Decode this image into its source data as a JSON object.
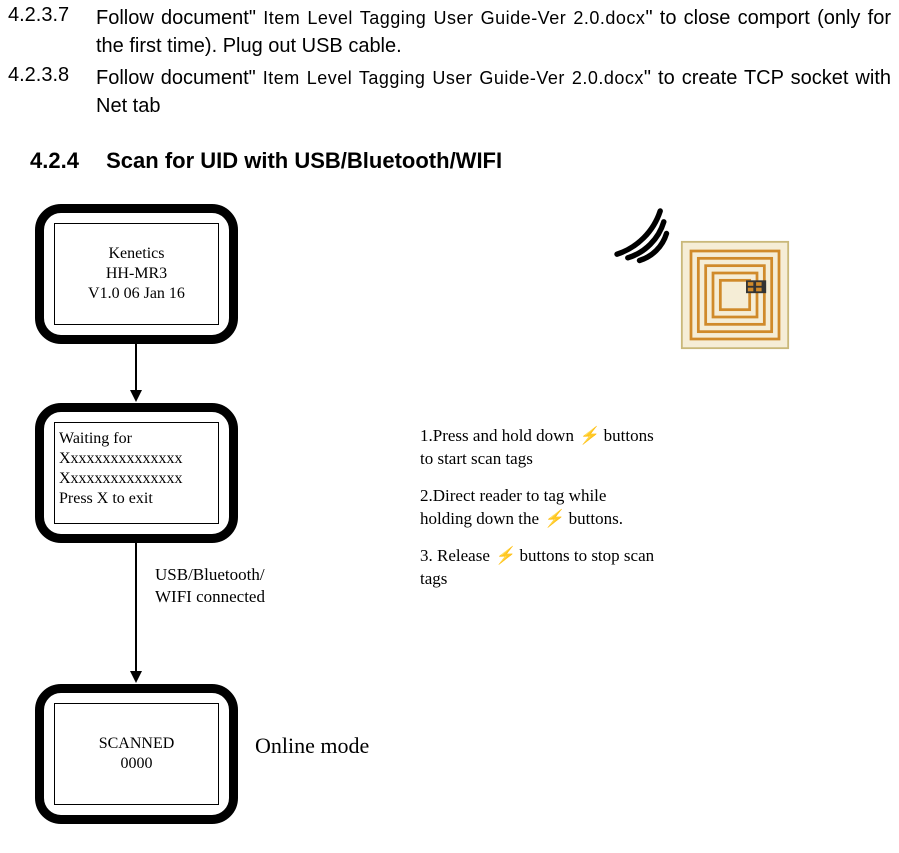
{
  "sections": {
    "s4237": {
      "num": "4.2.3.7",
      "pre": "Follow document\" ",
      "doc": "Item Level Tagging User Guide-Ver 2.0.docx",
      "post": "\" to close comport (only for the first time). Plug out USB cable."
    },
    "s4238": {
      "num": "4.2.3.8",
      "pre": "Follow document\" ",
      "doc": "Item Level Tagging User Guide-Ver 2.0.docx",
      "post": "\" to create TCP socket with Net tab"
    }
  },
  "heading": {
    "num": "4.2.4",
    "title": "Scan for UID with USB/Bluetooth/WIFI"
  },
  "screens": {
    "boot": {
      "l1": "Kenetics",
      "l2": "HH-MR3",
      "l3": "V1.0 06 Jan 16"
    },
    "wait": {
      "l1": " Waiting for",
      "l2": "Xxxxxxxxxxxxxxx",
      "l3": "Xxxxxxxxxxxxxxx",
      "l4": "Press X to exit"
    },
    "scanned": {
      "l1": "SCANNED",
      "l2": "0000"
    }
  },
  "arrow1_label": {
    "l1": "USB/Bluetooth/",
    "l2": "WIFI connected"
  },
  "mode_label": "Online mode",
  "instructions": {
    "i1a": "1.Press and hold down ",
    "i1b": " buttons to start scan tags",
    "i2a": "2.Direct reader to tag while holding down the ",
    "i2b": " buttons.",
    "i3a": "3. Release ",
    "i3b": " buttons to stop scan tags"
  },
  "icons": {
    "lightning": "⚡"
  }
}
